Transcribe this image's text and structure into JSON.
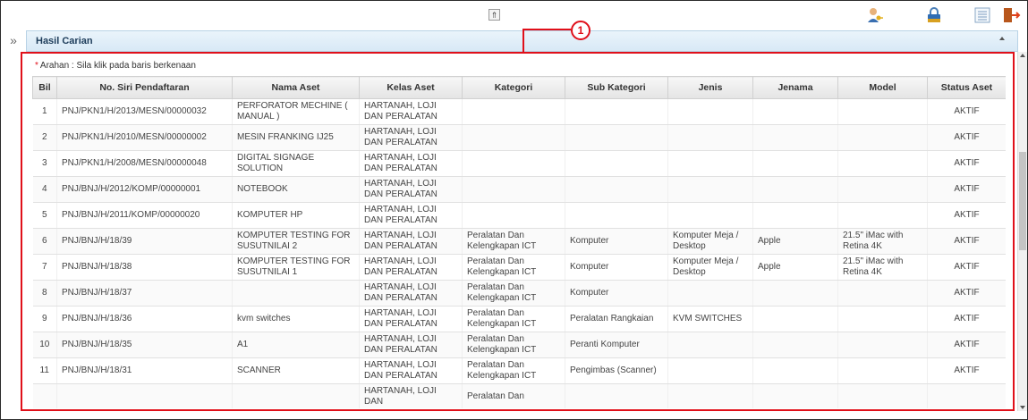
{
  "toolbar": {
    "collapse_glyph": "⇑",
    "icons": [
      "user-key-icon",
      "lock-icon",
      "list-view-icon",
      "logout-icon"
    ]
  },
  "left_strip": {
    "expand_glyph": "»"
  },
  "panel": {
    "title": "Hasil Carian"
  },
  "callout": {
    "number": "1",
    "color": "#e0101a"
  },
  "instruction": {
    "star": "*",
    "text": "Arahan : Sila klik pada baris berkenaan"
  },
  "table": {
    "headers": [
      "Bil",
      "No. Siri Pendaftaran",
      "Nama Aset",
      "Kelas Aset",
      "Kategori",
      "Sub Kategori",
      "Jenis",
      "Jenama",
      "Model",
      "Status Aset"
    ],
    "rows": [
      {
        "bil": "1",
        "siri": "PNJ/PKN1/H/2013/MESN/00000032",
        "nama": "PERFORATOR MECHINE ( MANUAL )",
        "kelas": "HARTANAH, LOJI DAN PERALATAN",
        "kategori": "",
        "sub": "",
        "jenis": "",
        "jenama": "",
        "model": "",
        "status": "AKTIF"
      },
      {
        "bil": "2",
        "siri": "PNJ/PKN1/H/2010/MESN/00000002",
        "nama": "MESIN FRANKING IJ25",
        "kelas": "HARTANAH, LOJI DAN PERALATAN",
        "kategori": "",
        "sub": "",
        "jenis": "",
        "jenama": "",
        "model": "",
        "status": "AKTIF"
      },
      {
        "bil": "3",
        "siri": "PNJ/PKN1/H/2008/MESN/00000048",
        "nama": "DIGITAL SIGNAGE SOLUTION",
        "kelas": "HARTANAH, LOJI DAN PERALATAN",
        "kategori": "",
        "sub": "",
        "jenis": "",
        "jenama": "",
        "model": "",
        "status": "AKTIF"
      },
      {
        "bil": "4",
        "siri": "PNJ/BNJ/H/2012/KOMP/00000001",
        "nama": "NOTEBOOK",
        "kelas": "HARTANAH, LOJI DAN PERALATAN",
        "kategori": "",
        "sub": "",
        "jenis": "",
        "jenama": "",
        "model": "",
        "status": "AKTIF"
      },
      {
        "bil": "5",
        "siri": "PNJ/BNJ/H/2011/KOMP/00000020",
        "nama": "KOMPUTER HP",
        "kelas": "HARTANAH, LOJI DAN PERALATAN",
        "kategori": "",
        "sub": "",
        "jenis": "",
        "jenama": "",
        "model": "",
        "status": "AKTIF"
      },
      {
        "bil": "6",
        "siri": "PNJ/BNJ/H/18/39",
        "nama": "KOMPUTER TESTING FOR SUSUTNILAI 2",
        "kelas": "HARTANAH, LOJI DAN PERALATAN",
        "kategori": "Peralatan Dan Kelengkapan ICT",
        "sub": "Komputer",
        "jenis": "Komputer Meja / Desktop",
        "jenama": "Apple",
        "model": "21.5\" iMac with Retina 4K",
        "status": "AKTIF"
      },
      {
        "bil": "7",
        "siri": "PNJ/BNJ/H/18/38",
        "nama": "KOMPUTER TESTING FOR SUSUTNILAI 1",
        "kelas": "HARTANAH, LOJI DAN PERALATAN",
        "kategori": "Peralatan Dan Kelengkapan ICT",
        "sub": "Komputer",
        "jenis": "Komputer Meja / Desktop",
        "jenama": "Apple",
        "model": "21.5\" iMac with Retina 4K",
        "status": "AKTIF"
      },
      {
        "bil": "8",
        "siri": "PNJ/BNJ/H/18/37",
        "nama": "",
        "kelas": "HARTANAH, LOJI DAN PERALATAN",
        "kategori": "Peralatan Dan Kelengkapan ICT",
        "sub": "Komputer",
        "jenis": "",
        "jenama": "",
        "model": "",
        "status": "AKTIF"
      },
      {
        "bil": "9",
        "siri": "PNJ/BNJ/H/18/36",
        "nama": "kvm switches",
        "kelas": "HARTANAH, LOJI DAN PERALATAN",
        "kategori": "Peralatan Dan Kelengkapan ICT",
        "sub": "Peralatan Rangkaian",
        "jenis": "KVM SWITCHES",
        "jenama": "",
        "model": "",
        "status": "AKTIF"
      },
      {
        "bil": "10",
        "siri": "PNJ/BNJ/H/18/35",
        "nama": "A1",
        "kelas": "HARTANAH, LOJI DAN PERALATAN",
        "kategori": "Peralatan Dan Kelengkapan ICT",
        "sub": "Peranti Komputer",
        "jenis": "",
        "jenama": "",
        "model": "",
        "status": "AKTIF"
      },
      {
        "bil": "11",
        "siri": "PNJ/BNJ/H/18/31",
        "nama": "SCANNER",
        "kelas": "HARTANAH, LOJI DAN PERALATAN",
        "kategori": "Peralatan Dan Kelengkapan ICT",
        "sub": "Pengimbas (Scanner)",
        "jenis": "",
        "jenama": "",
        "model": "",
        "status": "AKTIF"
      },
      {
        "bil": "",
        "siri": "",
        "nama": "",
        "kelas": "HARTANAH, LOJI DAN",
        "kategori": "Peralatan Dan",
        "sub": "",
        "jenis": "",
        "jenama": "",
        "model": "",
        "status": ""
      }
    ]
  }
}
